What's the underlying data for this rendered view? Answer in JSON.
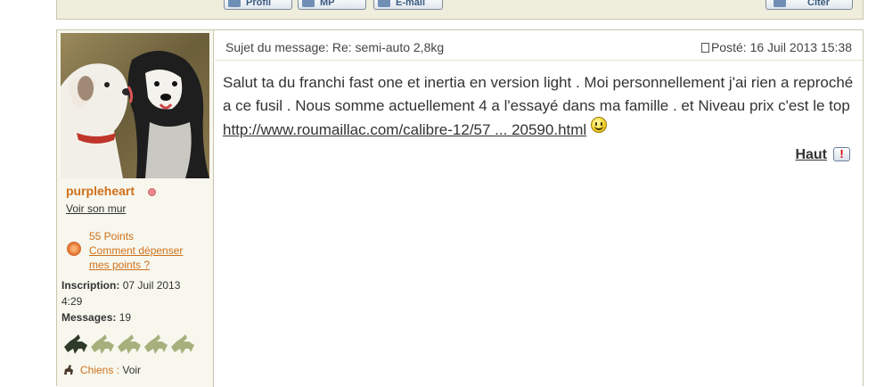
{
  "toolbar": {
    "profil_label": "Profil",
    "mp_label": "MP",
    "email_label": "E-mail",
    "citer_label": "Citer"
  },
  "user": {
    "name": "purpleheart",
    "wall_link": "Voir son mur",
    "points_value": "55 Points",
    "points_link": "Comment dépenser mes points ?",
    "inscription_label": "Inscription:",
    "inscription_value": "07 Juil 2013 4:29",
    "messages_label": "Messages:",
    "messages_value": "19",
    "chiens_label": "Chiens :",
    "chiens_value": "Voir",
    "rank_icon": "dog-silhouettes-rank-icon"
  },
  "post": {
    "subject_label": "Sujet du message:",
    "subject": "Re: semi-auto 2,8kg",
    "posted_label": "Posté:",
    "posted_date": "16 Juil 2013 15:38",
    "body_text": "Salut ta du franchi fast one et inertia en version light . Moi personnellement j'ai rien a reproché a ce fusil . Nous somme actuellement 4 a l'essayé dans ma famille . et Niveau prix c'est le top",
    "link_text": "http://www.roumaillac.com/calibre-12/57 ... 20590.html",
    "haut_label": "Haut",
    "report_symbol": "!"
  },
  "colors": {
    "accent_orange": "#d0701a",
    "panel_bg": "#f7f7ee",
    "border": "#c8c6ac"
  }
}
